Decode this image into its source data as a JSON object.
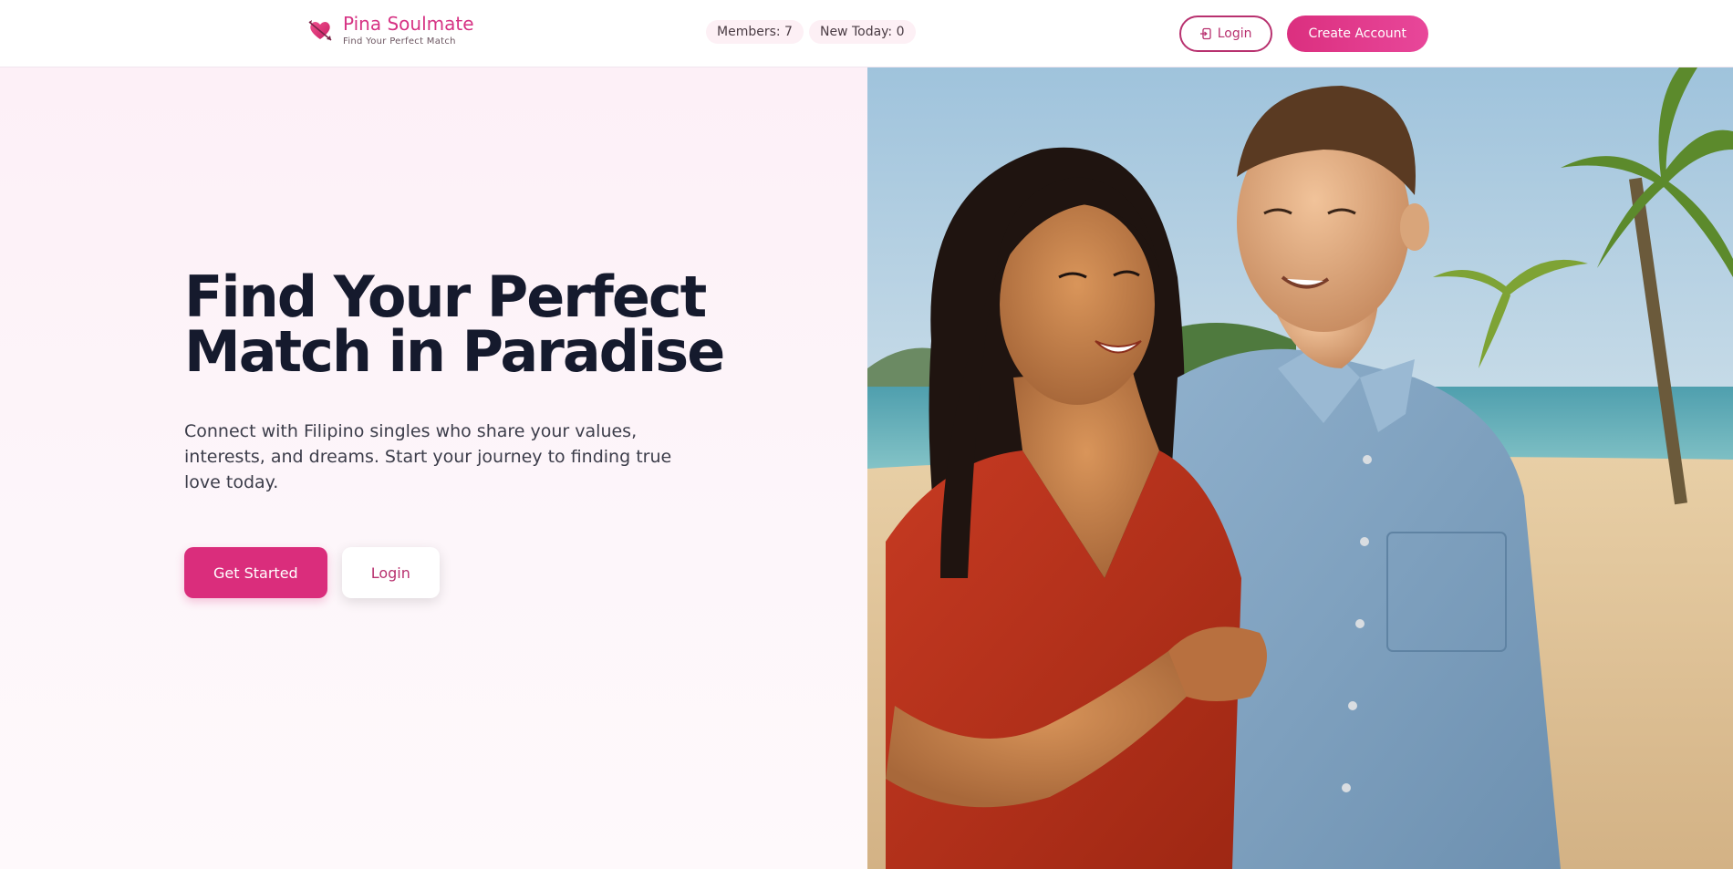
{
  "brand": {
    "name": "Pina Soulmate",
    "tagline": "Find Your Perfect Match",
    "icon": "heart-arrow-icon",
    "color": "#d63384"
  },
  "stats": {
    "members": "Members: 7",
    "new_today": "New Today: 0"
  },
  "auth": {
    "login_label": "Login",
    "create_account_label": "Create Account"
  },
  "hero": {
    "title_line1": "Find Your Perfect",
    "title_line2": "Match in Paradise",
    "subtitle": "Connect with Filipino singles who share your values, interests, and dreams. Start your journey to finding true love today.",
    "get_started_label": "Get Started",
    "login_label": "Login"
  },
  "colors": {
    "accent": "#da2d7c",
    "hero_bg": "#fdf0f7",
    "title": "#151a2d"
  }
}
